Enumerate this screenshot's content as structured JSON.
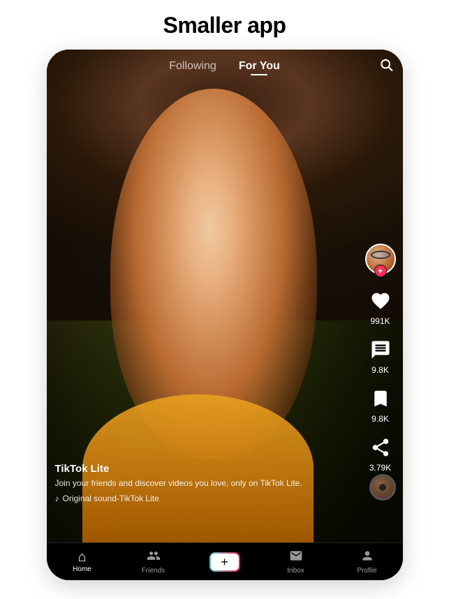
{
  "page": {
    "title": "Smaller app"
  },
  "header": {
    "following_tab": "Following",
    "for_you_tab": "For You",
    "active_tab": "for_you"
  },
  "video": {
    "username": "TikTok Lite",
    "description": "Join your friends and discover videos you love, only on TikTok Lite.",
    "sound": "Original sound-TikTok Lite"
  },
  "actions": {
    "like_count": "991K",
    "comment_count": "9.8K",
    "save_count": "9.8K",
    "share_count": "3.79K"
  },
  "bottom_nav": {
    "home_label": "Home",
    "friends_label": "Friends",
    "inbox_label": "Inbox",
    "profile_label": "Profile",
    "add_icon": "+"
  }
}
